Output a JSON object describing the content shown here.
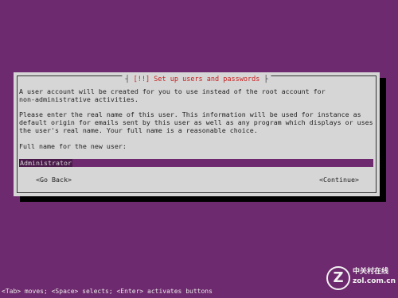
{
  "dialog": {
    "title_prefix": "[!!] ",
    "title": "Set up users and passwords",
    "intro": "A user account will be created for you to use instead of the root account for\nnon-administrative activities.",
    "instructions": "Please enter the real name of this user. This information will be used for instance as\ndefault origin for emails sent by this user as well as any program which displays or uses\nthe user's real name. Your full name is a reasonable choice.",
    "prompt": "Full name for the new user:",
    "full_name_value": "Administrator",
    "go_back_label": "<Go Back>",
    "continue_label": "<Continue>"
  },
  "status_bar": {
    "text": "<Tab> moves; <Space> selects; <Enter> activates buttons"
  },
  "watermark": {
    "logo_letter": "Z",
    "brand_cn": "中关村在线",
    "url": "zol.com.cn"
  },
  "colors": {
    "background": "#6e2a6e",
    "dialog": "#d6d6d6",
    "title_red": "#c81e1e"
  }
}
